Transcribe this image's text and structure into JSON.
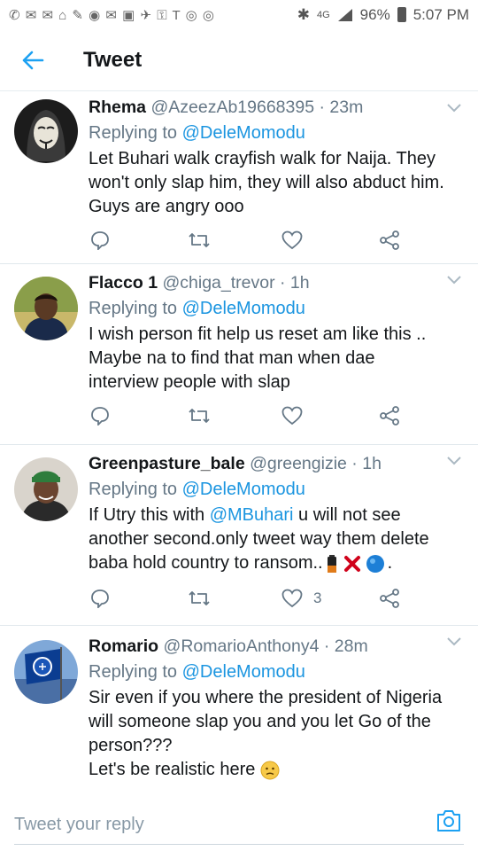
{
  "status_bar": {
    "notification_icons": "✆ ✉ ✉ ⌂ ✎ ◉ ✉ ▣ ✈ ⚿ T ◎ ◎",
    "bluetooth": "✱",
    "network": "4G",
    "battery": "96%",
    "time": "5:07 PM"
  },
  "header": {
    "title": "Tweet"
  },
  "tweets": [
    {
      "name": "Rhema",
      "handle": "@AzeezAb19668395",
      "time": "23m",
      "replying_prefix": "Replying to",
      "replying_to": "@DeleMomodu",
      "lines": [
        "Let Buhari walk crayfish walk for Naija. They",
        "won't only slap him, they will also abduct him.",
        "Guys are angry ooo"
      ],
      "likes": ""
    },
    {
      "name": "Flacco 1",
      "handle": "@chiga_trevor",
      "time": "1h",
      "replying_prefix": "Replying to",
      "replying_to": "@DeleMomodu",
      "lines": [
        "I wish person fit help us reset am like this ..",
        "Maybe na to find that man when dae",
        "interview people with slap"
      ],
      "likes": ""
    },
    {
      "name": "Greenpasture_bale",
      "handle": "@greengizie",
      "time": "1h",
      "replying_prefix": "Replying to",
      "replying_to": "@DeleMomodu",
      "line1_before": "If Utry this with ",
      "line1_mention": "@MBuhari",
      "line1_after": " u will not see",
      "lines": [
        "another second.only tweet way them delete",
        "baba hold country to ransom.."
      ],
      "likes": "3"
    },
    {
      "name": "Romario",
      "handle": "@RomarioAnthony4",
      "time": "28m",
      "replying_prefix": "Replying to",
      "replying_to": "@DeleMomodu",
      "lines": [
        "Sir even if you where the president of Nigeria",
        "will someone slap you and you let Go of the",
        "person???",
        "Let's be realistic here"
      ],
      "likes": ""
    }
  ],
  "reply": {
    "placeholder": "Tweet your reply"
  }
}
